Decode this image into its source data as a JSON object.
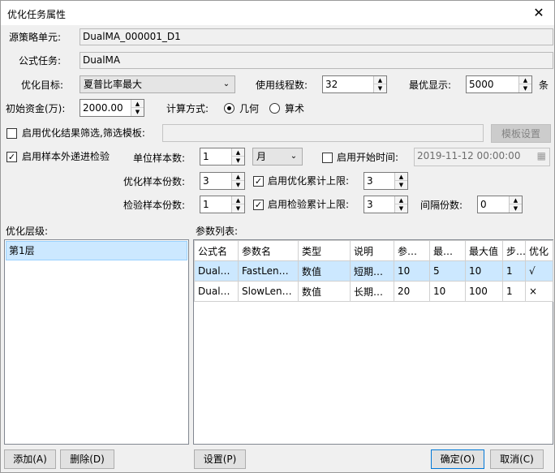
{
  "window": {
    "title": "优化任务属性",
    "close_glyph": "✕"
  },
  "source_unit": {
    "label": "源策略单元:",
    "value": "DualMA_000001_D1"
  },
  "formula_task": {
    "label": "公式任务:",
    "value": "DualMA"
  },
  "opt_target": {
    "label": "优化目标:",
    "value": "夏普比率最大",
    "arrow": "⌄"
  },
  "threads": {
    "label": "使用线程数:",
    "value": "32"
  },
  "max_show": {
    "label": "最优显示:",
    "value": "5000",
    "unit": "条"
  },
  "init_capital": {
    "label": "初始资金(万):",
    "value": "2000.00"
  },
  "calc_method": {
    "label": "计算方式:",
    "geometric": "几何",
    "arithmetic": "算术",
    "selected": "geometric"
  },
  "result_filter": {
    "label": "启用优化结果筛选,筛选模板:",
    "checked": false,
    "template_value": "",
    "template_button": "模板设置"
  },
  "walk_forward": {
    "label": "启用样本外递进检验",
    "checked": true
  },
  "unit_sample": {
    "label": "单位样本数:",
    "value": "1",
    "unit_value": "月",
    "arrow": "⌄"
  },
  "start_time": {
    "label": "启用开始时间:",
    "checked": false,
    "value": "2019-11-12 00:00:00"
  },
  "opt_samples": {
    "label": "优化样本份数:",
    "value": "3"
  },
  "opt_cumulative": {
    "label": "启用优化累计上限:",
    "checked": true,
    "value": "3"
  },
  "test_samples": {
    "label": "检验样本份数:",
    "value": "1"
  },
  "test_cumulative": {
    "label": "启用检验累计上限:",
    "checked": true,
    "value": "3"
  },
  "interval": {
    "label": "间隔份数:",
    "value": "0"
  },
  "levels": {
    "label": "优化层级:",
    "items": [
      "第1层"
    ]
  },
  "params": {
    "label": "参数列表:",
    "columns": [
      "公式名",
      "参数名",
      "类型",
      "说明",
      "参数值",
      "最小值",
      "最大值",
      "步长",
      "优化"
    ],
    "rows": [
      [
        "DualMA",
        "FastLength",
        "数值",
        "短期均线周期",
        "10",
        "5",
        "10",
        "1",
        "√"
      ],
      [
        "DualMA",
        "SlowLength",
        "数值",
        "长期均线周期",
        "20",
        "10",
        "100",
        "1",
        "×"
      ]
    ]
  },
  "buttons": {
    "add": "添加(A)",
    "delete": "删除(D)",
    "settings": "设置(P)",
    "ok": "确定(O)",
    "cancel": "取消(C)"
  },
  "icons": {
    "check": "✓",
    "spin_up": "▲",
    "spin_down": "▼",
    "calendar": "▦"
  }
}
